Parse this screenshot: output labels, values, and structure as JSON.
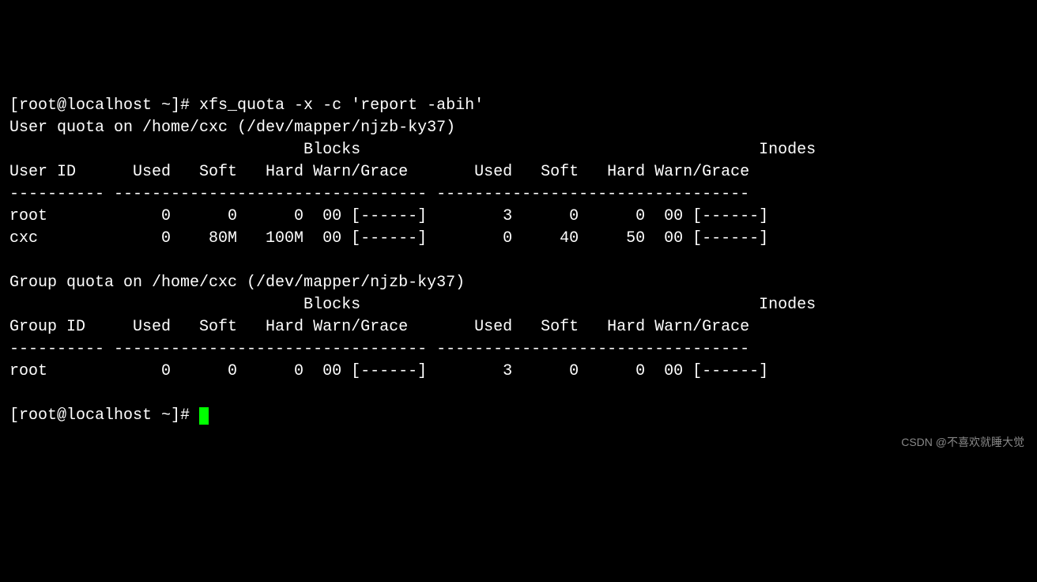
{
  "prompt1": "[root@localhost ~]# xfs_quota -x -c 'report -abih'",
  "user_quota_header": "User quota on /home/cxc (/dev/mapper/njzb-ky37)",
  "section_headers": "                               Blocks                                          Inodes",
  "user_columns": "User ID      Used   Soft   Hard Warn/Grace       Used   Soft   Hard Warn/Grace",
  "divider": "---------- --------------------------------- ---------------------------------",
  "user_rows": [
    "root            0      0      0  00 [------]        3      0      0  00 [------]",
    "cxc             0    80M   100M  00 [------]        0     40     50  00 [------]"
  ],
  "group_quota_header": "Group quota on /home/cxc (/dev/mapper/njzb-ky37)",
  "group_columns": "Group ID     Used   Soft   Hard Warn/Grace       Used   Soft   Hard Warn/Grace",
  "group_rows": [
    "root            0      0      0  00 [------]        3      0      0  00 [------]"
  ],
  "prompt2": "[root@localhost ~]# ",
  "watermark": "CSDN @不喜欢就睡大觉"
}
